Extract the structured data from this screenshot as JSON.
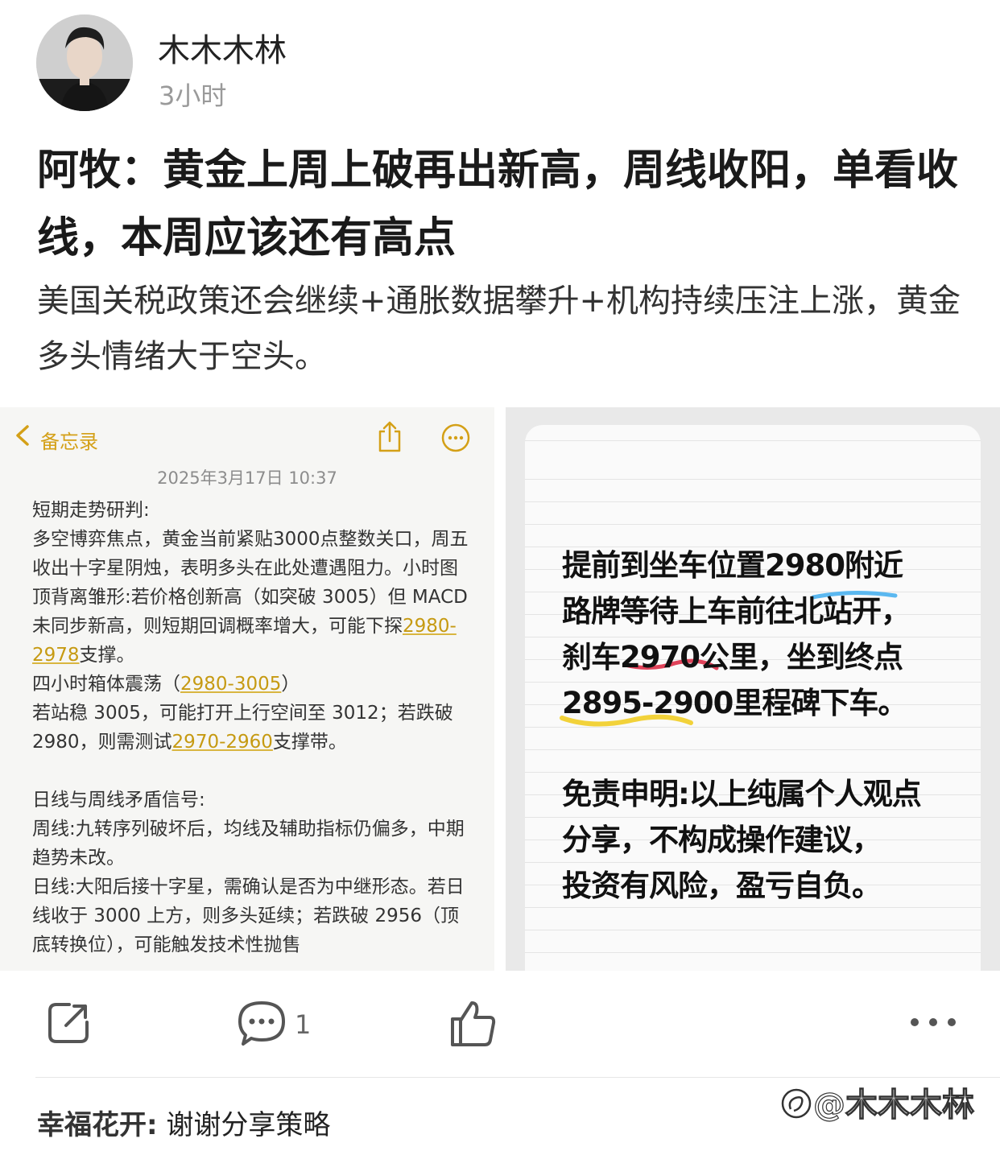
{
  "post": {
    "author": "木木木林",
    "time": "3小时",
    "title": "阿牧：黄金上周上破再出新高，周线收阳，单看收线，本周应该还有高点",
    "subtitle": "美国关税政策还会继续+通胀数据攀升+机构持续压注上涨，黄金多头情绪大于空头。"
  },
  "notes": {
    "back_label": "备忘录",
    "date": "2025年3月17日 10:37",
    "p1": "短期走势研判:",
    "p2a": "多空博弈焦点，黄金当前紧贴3000点整数关口，周五收出十字星阴烛，表明多头在此处遭遇阻力。小时图顶背离雏形:若价格创新高（如突破 3005）但 MACD 未同步新高，则短期回调概率增大，可能下探",
    "p2b": "2980-2978",
    "p2c": "支撑。",
    "p3a": "四小时箱体震荡（",
    "p3b": "2980-3005",
    "p3c": "）",
    "p4a": "若站稳 3005，可能打开上行空间至 3012；若跌破 2980，则需测试",
    "p4b": "2970-2960",
    "p4c": "支撑带。",
    "p5": "日线与周线矛盾信号:",
    "p6": "周线:九转序列破坏后，均线及辅助指标仍偏多，中期趋势未改。",
    "p7": "日线:大阳后接十字星，需确认是否为中继形态。若日线收于 3000 上方，则多头延续；若跌破 2956（顶底转换位），可能触发技术性抛售"
  },
  "handwritten": {
    "l1": "提前到坐车位置2980附近",
    "l2": "路牌等待上车前往北站开，",
    "l3": "刹车2970公里，坐到终点",
    "l4": "2895-2900里程碑下车。",
    "l5": "免责申明:以上纯属个人观点",
    "l6": "分享，不构成操作建议，",
    "l7": "投资有风险，盈亏自负。"
  },
  "actions": {
    "comment_count": "1"
  },
  "comment": {
    "user": "幸福花开:",
    "text": " 谢谢分享策略"
  },
  "watermark": "@木木木林",
  "colors": {
    "notes_accent": "#d4a017",
    "highlight_blue": "#5bb8f0",
    "highlight_red": "#e0435a",
    "highlight_yellow": "#f2d23a"
  }
}
